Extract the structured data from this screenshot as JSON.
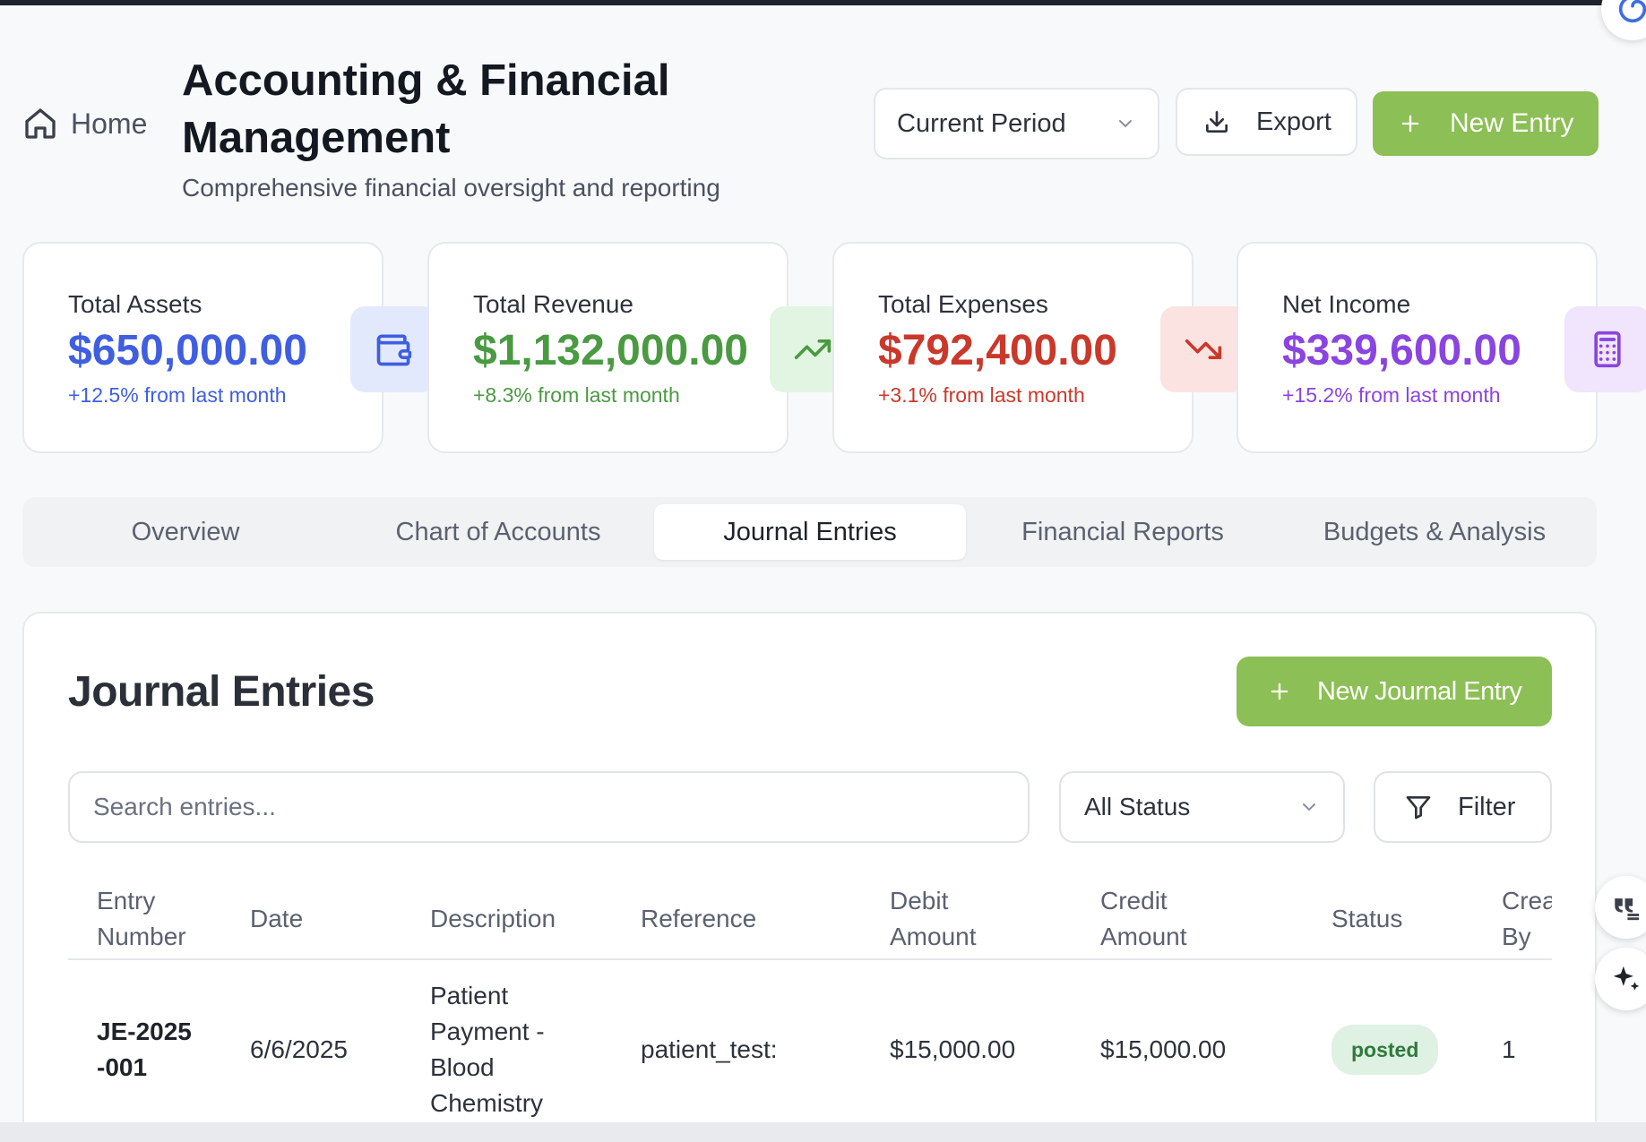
{
  "header": {
    "home_label": "Home",
    "title": "Accounting & Financial Management",
    "subtitle": "Comprehensive financial oversight and reporting",
    "period_select": "Current Period",
    "export_label": "Export",
    "new_entry_label": "New Entry"
  },
  "stats": [
    {
      "label": "Total Assets",
      "value": "$650,000.00",
      "change": "+12.5% from last month",
      "color": "#3f5ee0",
      "icon": "wallet-icon"
    },
    {
      "label": "Total Revenue",
      "value": "$1,132,000.00",
      "change": "+8.3% from last month",
      "color": "#4a9a42",
      "icon": "trending-up-icon"
    },
    {
      "label": "Total Expenses",
      "value": "$792,400.00",
      "change": "+3.1% from last month",
      "color": "#c9392b",
      "icon": "trending-down-icon"
    },
    {
      "label": "Net Income",
      "value": "$339,600.00",
      "change": "+15.2% from last month",
      "color": "#8a44e0",
      "icon": "calculator-icon"
    }
  ],
  "tabs": [
    {
      "label": "Overview",
      "active": false
    },
    {
      "label": "Chart of Accounts",
      "active": false
    },
    {
      "label": "Journal Entries",
      "active": true
    },
    {
      "label": "Financial Reports",
      "active": false
    },
    {
      "label": "Budgets & Analysis",
      "active": false
    }
  ],
  "journal": {
    "title": "Journal Entries",
    "new_button": "New Journal Entry",
    "search_placeholder": "Search entries...",
    "status_filter": "All Status",
    "filter_label": "Filter",
    "columns": [
      "Entry Number",
      "Date",
      "Description",
      "Reference",
      "Debit Amount",
      "Credit Amount",
      "Status",
      "Created By"
    ],
    "rows": [
      {
        "entry_number": "JE-2025-001",
        "date": "6/6/2025",
        "description": "Patient Payment - Blood Chemistry",
        "reference": "patient_test:",
        "debit": "$15,000.00",
        "credit": "$15,000.00",
        "status": "posted",
        "created_by": "1"
      }
    ]
  },
  "colors": {
    "accent_green": "#8cbf55",
    "status_posted_bg": "#dff1e3",
    "status_posted_text": "#2f7a3d"
  }
}
